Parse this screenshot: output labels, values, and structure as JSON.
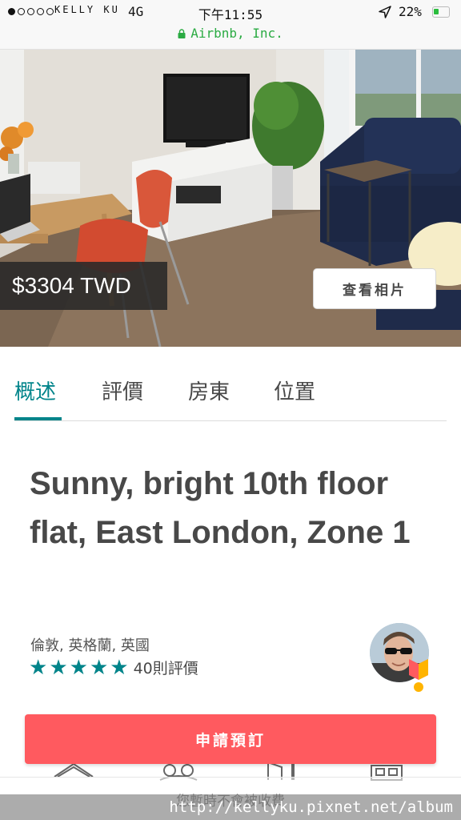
{
  "status_bar": {
    "carrier": "KELLY KU",
    "network": "4G",
    "time": "下午11:55",
    "battery": "22%",
    "url": "Airbnb, Inc."
  },
  "icons": {
    "signal": "signal-dots-icon",
    "location": "location-arrow-icon",
    "battery": "battery-icon",
    "lock": "lock-icon",
    "superhost": "superhost-badge-icon"
  },
  "hero": {
    "price": "$3304 TWD",
    "view_photos": "查看相片"
  },
  "tabs": [
    {
      "label": "概述",
      "active": true
    },
    {
      "label": "評價",
      "active": false
    },
    {
      "label": "房東",
      "active": false
    },
    {
      "label": "位置",
      "active": false
    }
  ],
  "listing": {
    "title": "Sunny, bright 10th floor flat, East London, Zone 1",
    "location": "倫敦, 英格蘭, 英國",
    "rating": 5,
    "rating_max": 5,
    "reviews": "40則評價"
  },
  "booking": {
    "button": "申請預訂",
    "note": "您暫時不會被收費"
  },
  "watermark": "http://kellyku.pixnet.net/album",
  "colors": {
    "accent": "#00848a",
    "brand": "#ff5a5f",
    "url_green": "#2bab43"
  }
}
